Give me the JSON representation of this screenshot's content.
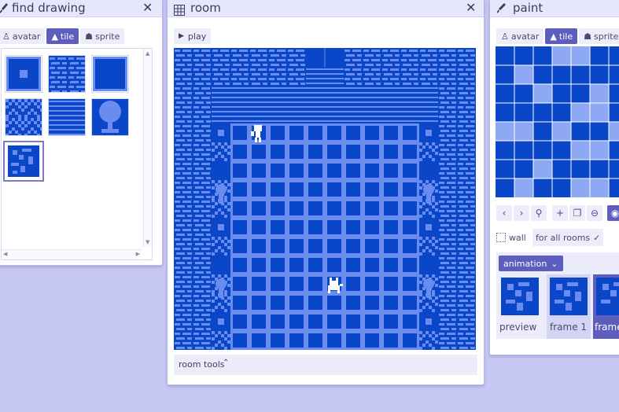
{
  "colors": {
    "background": "#c7c7f3",
    "tile_dark": "#0a46c8",
    "tile_light": "#6a8cf0",
    "accent": "#5d5dbd"
  },
  "find_drawing": {
    "title": "find drawing",
    "tabs": [
      {
        "label": "avatar",
        "icon": "person-icon"
      },
      {
        "label": "tile",
        "icon": "mountain-icon"
      },
      {
        "label": "sprite",
        "icon": "cat-icon"
      }
    ],
    "selected_tab": "tile"
  },
  "room": {
    "title": "room",
    "play_label": "play",
    "room_tools_label": "room tools"
  },
  "paint": {
    "title": "paint",
    "tabs": [
      {
        "label": "avatar",
        "icon": "person-icon"
      },
      {
        "label": "tile",
        "icon": "mountain-icon"
      },
      {
        "label": "sprite",
        "icon": "cat-icon"
      }
    ],
    "selected_tab": "tile",
    "wall_label": "wall",
    "for_all_rooms_label": "for all rooms",
    "animation_label": "animation",
    "frames": [
      {
        "label": "preview"
      },
      {
        "label": "frame 1"
      },
      {
        "label": "frame"
      }
    ]
  }
}
